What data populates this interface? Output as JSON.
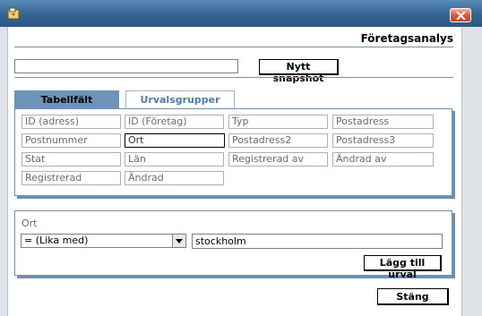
{
  "window": {
    "close_icon": "close-x-icon",
    "app_icon": "app-icon"
  },
  "header": {
    "title": "Företagsanalys"
  },
  "snapshot": {
    "input_value": "",
    "button_label": "Nytt snapshot"
  },
  "tabs": [
    {
      "label": "Tabellfält",
      "active": true
    },
    {
      "label": "Urvalsgrupper",
      "active": false
    }
  ],
  "fields": [
    "ID (adress)",
    "ID (Företag)",
    "Typ",
    "Postadress",
    "Postnummer",
    "Ort",
    "Postadress2",
    "Postadress3",
    "Stat",
    "Län",
    "Registrerad av",
    "Ändrad av",
    "Registrerad",
    "Ändrad"
  ],
  "selected_field": "Ort",
  "filter": {
    "label": "Ort",
    "operator": "= (Lika med)",
    "value": "stockholm",
    "add_button_label": "Lägg till urval"
  },
  "footer": {
    "close_label": "Stäng"
  },
  "colors": {
    "titlebar": "#33638e",
    "accent": "#6d94b8",
    "tab_inactive_text": "#4f7ca6"
  }
}
